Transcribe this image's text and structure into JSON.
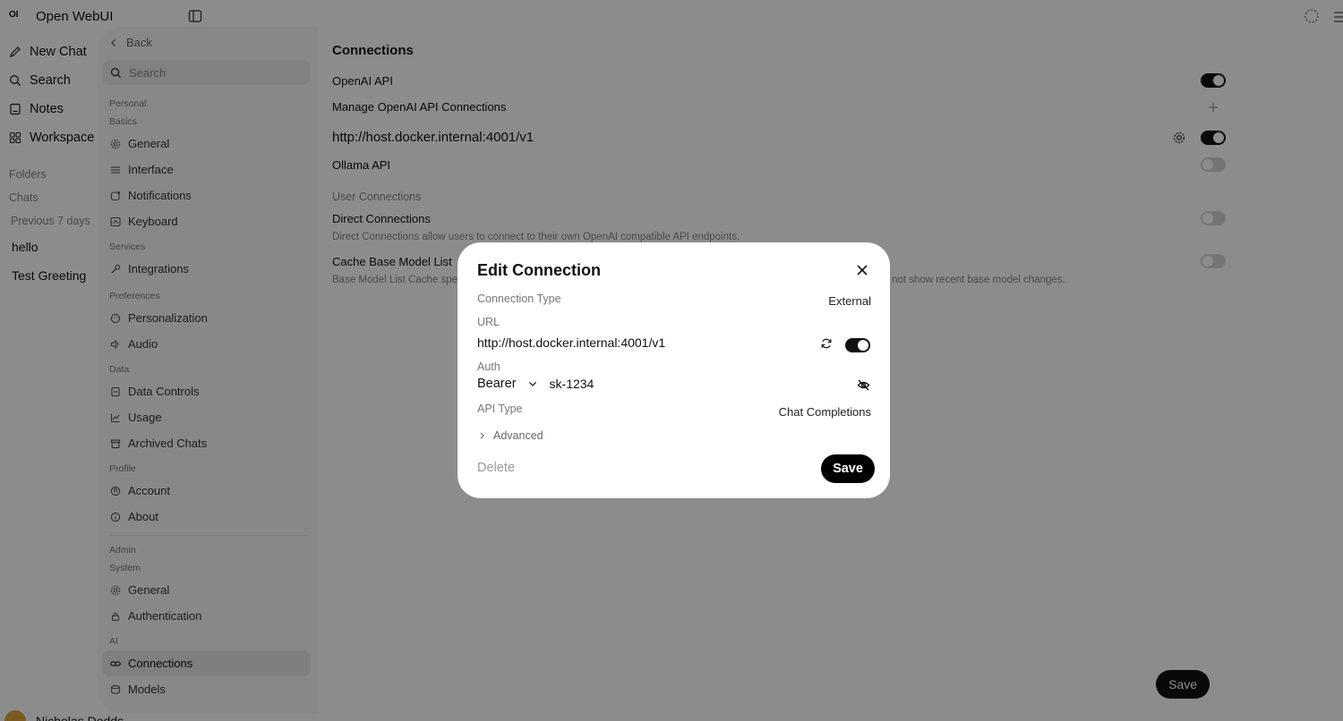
{
  "app": {
    "logo": "OI",
    "title": "Open WebUI"
  },
  "sidebar": {
    "nav": [
      {
        "label": "New Chat",
        "icon": "pencil-icon"
      },
      {
        "label": "Search",
        "icon": "search-icon"
      },
      {
        "label": "Notes",
        "icon": "notes-icon"
      },
      {
        "label": "Workspace",
        "icon": "grid-icon"
      }
    ],
    "folders_label": "Folders",
    "chats_label": "Chats",
    "period_label": "Previous 7 days",
    "chats": [
      "hello",
      "Test Greeting"
    ],
    "user_name": "Nicholas Dodds"
  },
  "settings": {
    "back_label": "Back",
    "search_placeholder": "Search",
    "groups": {
      "personal": "Personal",
      "basics": "Basics",
      "services": "Services",
      "preferences": "Preferences",
      "data": "Data",
      "profile": "Profile",
      "admin": "Admin",
      "system": "System",
      "ai": "AI"
    },
    "items": {
      "general": "General",
      "interface": "Interface",
      "notifications": "Notifications",
      "keyboard": "Keyboard",
      "integrations": "Integrations",
      "personalization": "Personalization",
      "audio": "Audio",
      "data_controls": "Data Controls",
      "usage": "Usage",
      "archived_chats": "Archived Chats",
      "account": "Account",
      "about": "About",
      "sys_general": "General",
      "authentication": "Authentication",
      "connections": "Connections",
      "models": "Models"
    },
    "main": {
      "title": "Connections",
      "openai_api": "OpenAI API",
      "manage_openai": "Manage OpenAI API Connections",
      "connection_url": "http://host.docker.internal:4001/v1",
      "ollama_api": "Ollama API",
      "user_connections": "User Connections",
      "direct_connections": "Direct Connections",
      "direct_desc": "Direct Connections allow users to connect to their own OpenAI compatible API endpoints.",
      "cache_base": "Cache Base Model List",
      "cache_desc_start": "Base Model List Cache spe",
      "cache_desc_end": "not show recent base model changes.",
      "save_label": "Save"
    },
    "toggles": {
      "openai": true,
      "connection": true,
      "ollama": false,
      "direct": false,
      "cache": false
    }
  },
  "dialog": {
    "title": "Edit Connection",
    "connection_type_label": "Connection Type",
    "connection_type_value": "External",
    "url_label": "URL",
    "url_value": "http://host.docker.internal:4001/v1",
    "url_enabled": true,
    "auth_label": "Auth",
    "auth_type": "Bearer",
    "auth_key": "sk-1234",
    "api_type_label": "API Type",
    "api_type_value": "Chat Completions",
    "advanced_label": "Advanced",
    "delete_label": "Delete",
    "save_label": "Save"
  }
}
